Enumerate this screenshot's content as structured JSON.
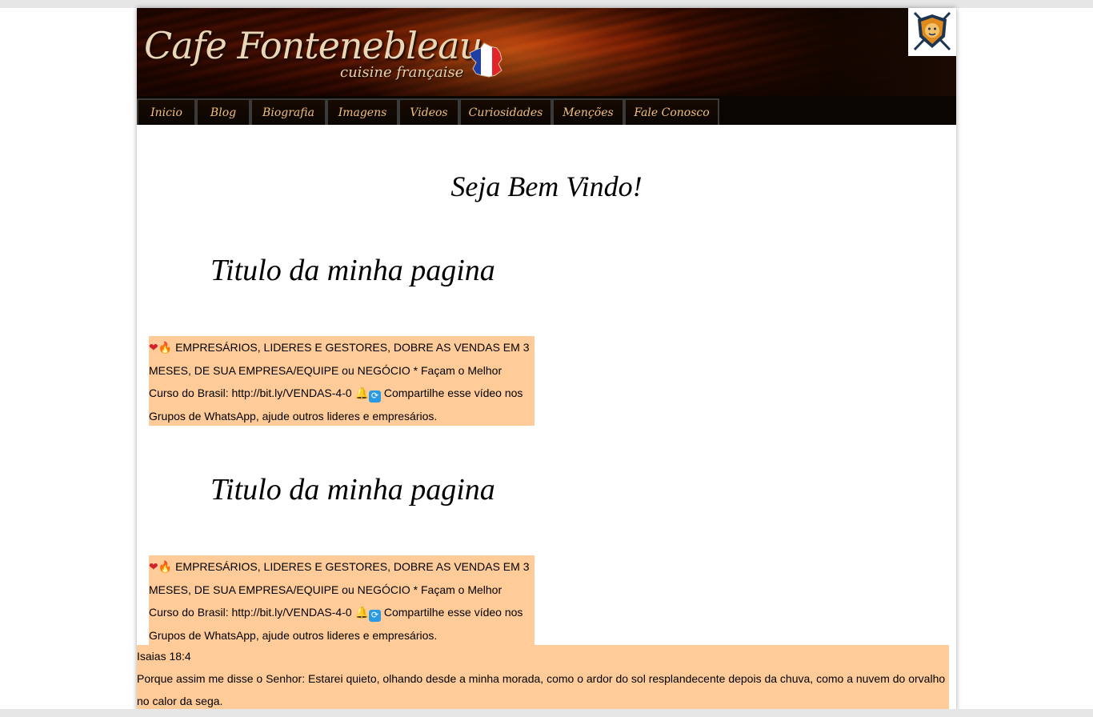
{
  "header": {
    "brand": "Cafe Fontenebleau",
    "subtitle": "cuisine française",
    "flag_icon": "france-map-flag-icon",
    "badge_icon": "lion-shield-badge-icon"
  },
  "nav": {
    "items": [
      "Inicio",
      "Blog",
      "Biografia",
      "Imagens",
      "Videos",
      "Curiosidades",
      "Menções",
      "Fale Conosco"
    ]
  },
  "main": {
    "welcome": "Seja Bem Vindo!",
    "posts": [
      {
        "title": "Titulo da minha pagina",
        "text": "EMPRESÁRIOS, LIDERES E GESTORES, DOBRE AS VENDAS EM 3 MESES, DE SUA EMPRESA/EQUIPE ou NEGÓCIO * Façam o Melhor Curso do Brasil: http://bit.ly/VENDAS-4-0",
        "text_after": "Compartilhe esse vídeo nos Grupos de WhatsApp, ajude outros lideres e empresários."
      },
      {
        "title": "Titulo da minha pagina",
        "text": "EMPRESÁRIOS, LIDERES E GESTORES, DOBRE AS VENDAS EM 3 MESES, DE SUA EMPRESA/EQUIPE ou NEGÓCIO * Façam o Melhor Curso do Brasil: http://bit.ly/VENDAS-4-0",
        "text_after": "Compartilhe esse vídeo nos Grupos de WhatsApp, ajude outros lideres e empresários."
      }
    ]
  },
  "verse": {
    "reference": "Isaias 18:4",
    "text": "Porque assim me disse o Senhor: Estarei quieto, olhando desde a minha morada, como o ardor do sol resplandecente depois da chuva, como a nuvem do orvalho no calor da sega."
  },
  "colors": {
    "highlight": "#ffcc99",
    "nav_text": "#f0c080",
    "nav_bg": "#0b0501"
  }
}
